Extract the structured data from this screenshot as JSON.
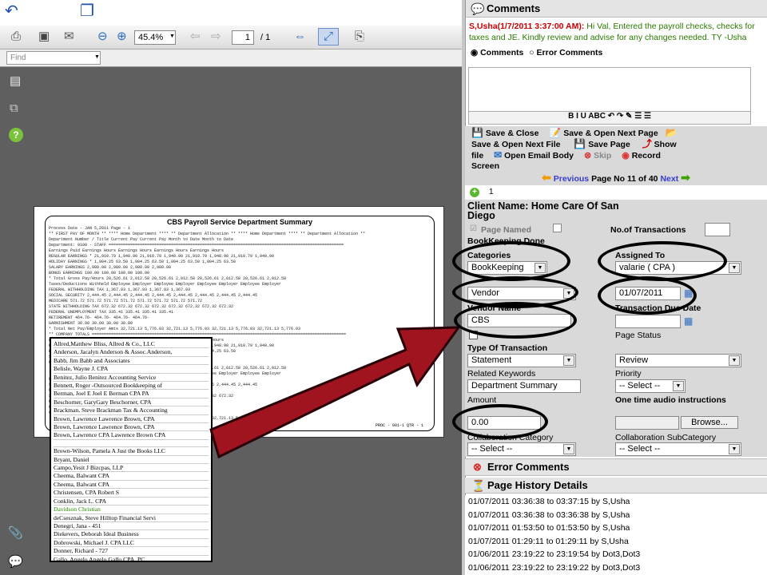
{
  "pdf_viewer": {
    "zoom": "45.4%",
    "current_page": "1",
    "total_pages": "/ 1",
    "find_placeholder": "Find"
  },
  "report": {
    "title": "CBS Payroll Service Department Summary",
    "lines": [
      "Process Date - JAN 5,2011                                                                                       Page -  1",
      "** FIRST PAY OF MONTH **    **** Home Department ****    ** Department Allocation **   **** Home Department ****   ** Department Allocation **",
      "Department  Number / Title          Current Pay               Current Pay                Month to Date             Month to Date",
      "Department: 0100 - STAFF ==================================================================================================",
      "  Earnings Paid                 Earnings      Hours      Earnings      Hours      Earnings      Hours      Earnings      Hours",
      "     REGULAR EARNINGS      *    21,910.79   1,948.90    21,910.79   1,948.90    21,910.79   1,948.90    21,910.79   1,948.90",
      "     HOLIDAY EARNINGS      *     1,004.25      63.50     1,004.25      63.50     1,004.25      63.50     1,004.25      63.50",
      "     SALARY EARNINGS             2,980.00                 2,980.00                 2,980.00                 2,980.00",
      "     BONUS EARNINGS                100.00                   100.00                   100.00                   100.00",
      "* Total Gross Pay/Hours         20,526.61   2,012.58    20,526.61   2,012.58    20,526.61   2,012.58    20,526.61   2,012.58",
      "  Taxes/Deductions Withheld      Employee    Employer     Employee    Employer     Employee    Employer     Employee    Employer",
      "     FEDERAL WITHHOLDING TAX        1,367.93                 1,367.93                 1,367.93                 1,367.93",
      "     SOCIAL SECURITY                2,444.45    2,444.45     2,444.45    2,444.45     2,444.45    2,444.45     2,444.45    2,444.45",
      "     MEDICARE                         571.72      571.72       571.72      571.72       571.72      571.72       571.72      571.72",
      "     STATE WITHHOLDING TAX            672.32      672.32       672.32      672.32       672.32      672.32       672.32      672.32",
      "     FEDERAL UNEMPLOYMENT TAX                     335.41                   335.41                   335.41                   335.41",
      "     RETIREMENT                       464.76-                  464.76-                  464.76-                  464.76-",
      "     GARNISHMENT                       30.00                    30.00                    30.00                    30.00",
      "* Total Net Pay/Employer Amts   32,721.13   5,776.03    32,721.13   5,776.03    32,721.13   5,776.03    32,721.13   5,776.03",
      "",
      "** COMPANY TOTALS ==========================================================================================================",
      "  Earnings Paid                 Earnings      Hours      Earnings      Hours      Earnings      Hours      Earnings      Hours",
      "     REGULAR EARNINGS      *    21,910.79   1,948.90    21,910.79   1,948.90    21,910.79   1,948.90    21,910.79   1,948.90",
      "     HOLIDAY EARNINGS      *     1,004.25      63.50     1,004.25      63.50     1,004.25      63.50     1,004.25      63.50",
      "     SALARY EARNINGS             2,980.00                 2,980.00                 2,980.00                 2,980.00",
      "     BONUS EARNINGS                100.00                   100.00                   100.00                   100.00",
      "* Total Gross Pay/Hours         20,526.61   2,012.58    20,526.61   2,012.58    20,526.61   2,012.58    20,526.61   2,012.58",
      "  Taxes/Deductions Withheld      Employee    Employer     Employee    Employer     Employee    Employer     Employee    Employer",
      "     FEDERAL WITHHOLDING TAX        1,367.93                 1,367.93                 1,367.93                 1,367.93",
      "     SOCIAL SECURITY                2,444.45    2,444.45     2,444.45    2,444.45     2,444.45    2,444.45     2,444.45    2,444.45",
      "     MEDICARE                         571.72      571.72       571.72      571.72       571.72      571.72       571.72      571.72",
      "     STATE WITHHOLDING TAX            672.32      672.32       672.32      672.32       672.32      672.32       672.32      672.32",
      "     FEDERAL UNEMPLOYMENT TAX                     335.41                   335.41                   335.41                   335.41",
      "     RETIREMENT                       464.76-                  464.76-                  464.76-                  464.76-",
      "     GARNISHMENT                       30.00                    30.00                    30.00                    30.00",
      "* Total Net Pay/Employer Amts   32,721.13   5,776.03    32,721.13   5,776.03    32,721.13   5,776.03    32,721.13   5,776.03",
      "",
      "            * Employer does not include Fender Pay"
    ],
    "footer_left": "PROC - 001-1    QTR - 1"
  },
  "vendor_list": [
    "Allred,Matthew Bliss, Allred & Co., LLC",
    "Anderson, Jacalyn Anderson & Assoc.Anderson,",
    "Babb, Jim Babb and Associates",
    "Belisle, Wayne J. CPA",
    "Benitez, Julio Benitez Accounting Service",
    "Bennett, Roger -Outsourced Bookkeeping of",
    "Berman, Joel E Joel E Berman CPA PA",
    "Beschorner, GaryGary Beschorner, CPA",
    "Brackman, Steve Brackman Tax & Accounting",
    "Brown, Lawrence  Lawrence Brown, CPA",
    "Brown, Lawrence  Lawrence Brown, CPA",
    "Brown, Lawrence CPA Lawrence Brown CPA",
    "",
    "Brown-Wilson, Pamela A Just the Books LLC",
    "Bryant, Daniel",
    "Campo,Yesit J Bizcpas, LLP",
    "Cheema, Balwant CPA",
    "Cheema, Balwant CPA",
    "Christensen, CPA Robert S",
    "Conklin, Jack L. CPA",
    "Davidson Christian",
    "deCsesznak, Steve Hilltop Financial Servi",
    "Denegri, Jana - 451",
    "Diekevers, Deborah Ideal Business",
    "Dobrowski, Michael J. CPA LLC",
    "Donner, Richard - 727",
    "Gallo, Angelo Angelo Gallo CPA, PC",
    "Graham, William - 497",
    "Green, Aurthur Art Green"
  ],
  "comments": {
    "header": "Comments",
    "author": "S,Usha(1/7/2011 3:37:00 AM):",
    "message": " Hi Val, Entered the payroll checks, checks for taxes and JE. Kindly review and advise for any changes needed. TY -Usha",
    "radio_comments": "Comments",
    "radio_error": "Error Comments",
    "format_buttons": "B   I   U   ABC    ↶   ↷    ✎    ☰   ☰"
  },
  "actions": {
    "save_close": "Save & Close",
    "save_open_next_page": "Save & Open Next Page",
    "save_open_next_file": "Save & Open Next File",
    "save_page": "Save Page",
    "show_file": "Show",
    "file": "file",
    "open_email_body": "Open Email Body",
    "skip": "Skip",
    "record": "Record",
    "screen": "Screen"
  },
  "pager": {
    "previous": "Previous",
    "label": "Page No 11 of 40",
    "next": "Next"
  },
  "form": {
    "count": "1",
    "client_name": "Client Name: Home Care Of San Diego",
    "page_named": "Page Named",
    "no_transactions": "No.of Transactions",
    "bookkeeping_done": "BookKeeping Done",
    "categories_label": "Categories",
    "categories_value": "BookKeeping",
    "assigned_to_label": "Assigned To",
    "assigned_to_value": "valarie ( CPA )",
    "type_value": "Vendor",
    "date_value": "01/07/2011",
    "vendor_name_label": "Vendor Name",
    "vendor_name_value": "CBS",
    "transaction_due_date": "Transaction Due Date",
    "page_status_label": "Page Status",
    "page_status_value": "Review",
    "type_of_transaction_label": "Type Of Transaction",
    "type_of_transaction_value": "Statement",
    "related_keywords_label": "Related Keywords",
    "related_keywords_value": "Department Summary",
    "priority_label": "Priority",
    "priority_value": "-- Select --",
    "amount_label": "Amount",
    "amount_value": "0.00",
    "audio_label": "One time audio instructions",
    "browse": "Browse...",
    "collab_category_label": "Collaboration Category",
    "collab_category_value": "-- Select --",
    "collab_subcategory_label": "Collaboration SubCategory",
    "collab_subcategory_value": "-- Select --"
  },
  "error_comments": {
    "header": "Error Comments"
  },
  "history": {
    "header": "Page History Details",
    "items": [
      "01/07/2011 03:36:38 to 03:37:15 by S,Usha",
      "01/07/2011 03:36:38 to 03:36:38 by S,Usha",
      "01/07/2011 01:53:50 to 01:53:50 by S,Usha",
      "01/07/2011 01:29:11 to 01:29:11 by S,Usha",
      "01/06/2011 23:19:22 to 23:19:54 by Dot3,Dot3",
      "01/06/2011 23:19:22 to 23:19:22 by Dot3,Dot3",
      "01/06/2011 23:13:27 to 23:13:27 by Dot3,Dot3"
    ]
  }
}
